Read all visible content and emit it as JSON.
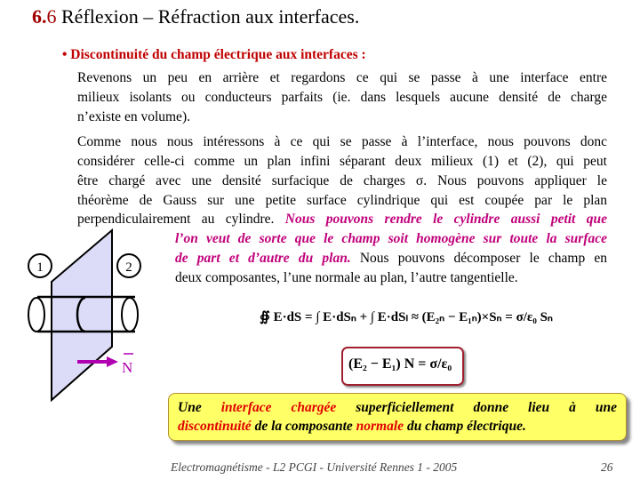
{
  "title": {
    "num_major": "6.",
    "num_minor": "6",
    "text": " Réflexion – Réfraction aux interfaces."
  },
  "subtitle": "• Discontinuité du champ électrique aux interfaces :",
  "para1": [
    "Revenons un peu en arrière et regardons ce qui se passe à une interface entre",
    "milieux isolants ou conducteurs parfaits (ie. dans lesquels aucune densité de charge",
    "n’existe en volume)."
  ],
  "para2": {
    "l1": "Comme nous nous intéressons à ce qui se passe à l’interface, nous pouvons donc",
    "l2": "considérer celle-ci comme un plan infini séparant deux milieux (1) et (2), qui peut",
    "l3": "être chargé avec une densité surfacique de charges σ. Nous pouvons appliquer le",
    "l4": "théorème de Gauss sur une petite surface cylindrique qui est coupée par le plan",
    "l5a": "perpendiculairement au cylindre.",
    "l5b": "Nous pouvons rendre le cylindre aussi petit que",
    "l6": "l’on veut de sorte que le champ soit homogène sur toute la surface",
    "l7a": "de part et d’autre du plan.",
    "l7b": "Nous pouvons décomposer le champ en",
    "l8": "deux composantes, l’une normale au plan, l’autre tangentielle."
  },
  "diagram": {
    "medium1": "1",
    "medium2": "2",
    "normal_label": "N",
    "plane_color": "#dcdcf8",
    "arrow_color": "#b000b0"
  },
  "equations": {
    "gauss": "∯ E·dS = ∫ E·dSₙ + ∫ E·dSₗ ≈ (E₂ₙ − E₁ₙ)×Sₙ = σ/ε₀ Sₙ",
    "result": "(E₂ − E₁) N = σ/ε₀"
  },
  "conclusion": {
    "w1": "Une",
    "w2": "interface chargée",
    "w3": "superficiellement donne lieu à une",
    "w4": "discontinuité",
    "w5": " de la composante ",
    "w6": "normale",
    "w7": " du champ électrique."
  },
  "footer": "Electromagnétisme - L2 PCGI - Université Rennes 1 - 2005",
  "page_number": "26"
}
